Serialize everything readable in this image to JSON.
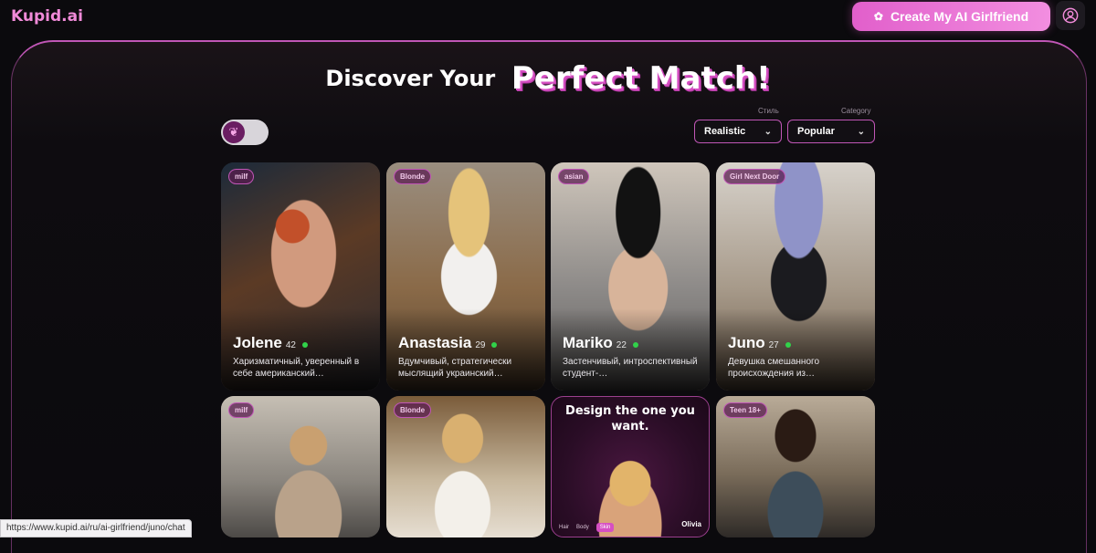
{
  "header": {
    "logo": "Kupid.ai",
    "create_button": "Create My AI Girlfriend"
  },
  "hero": {
    "title_left": "Discover Your",
    "title_right": "Perfect Match!"
  },
  "filters": {
    "style_label": "Стиль",
    "style_value": "Realistic",
    "category_label": "Category",
    "category_value": "Popular"
  },
  "cards": [
    {
      "tag": "milf",
      "name": "Jolene",
      "age": "42",
      "description": "Харизматичный, уверенный в себе американский…"
    },
    {
      "tag": "Blonde",
      "name": "Anastasia",
      "age": "29",
      "description": "Вдумчивый, стратегически мыслящий украинский…"
    },
    {
      "tag": "asian",
      "name": "Mariko",
      "age": "22",
      "description": "Застенчивый, интроспективный студент-…"
    },
    {
      "tag": "Girl Next Door",
      "name": "Juno",
      "age": "27",
      "description": "Девушка смешанного происхождения из…"
    },
    {
      "tag": "milf"
    },
    {
      "tag": "Blonde"
    },
    {
      "tag": "Teen 18+"
    }
  ],
  "design_card": {
    "title": "Design the one you want.",
    "tabs": [
      "Hair",
      "Body",
      "Skin"
    ],
    "name": "Olivia"
  },
  "status_url": "https://www.kupid.ai/ru/ai-girlfriend/juno/chat",
  "colors": {
    "accent": "#e15fcb",
    "online": "#31d24a",
    "background": "#0b0a0d"
  }
}
